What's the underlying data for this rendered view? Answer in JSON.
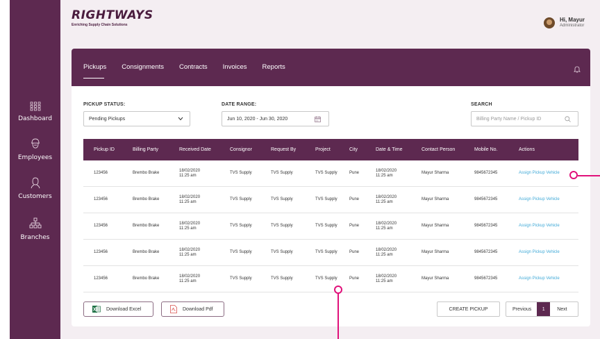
{
  "brand": {
    "name": "RIGHTWAYS",
    "tagline": "Enriching Supply Chain Solutions"
  },
  "user": {
    "greeting": "Hi, Mayur",
    "role": "Administrator"
  },
  "sidebar": {
    "items": [
      {
        "label": "Dashboard",
        "icon": "grid-icon"
      },
      {
        "label": "Employees",
        "icon": "helmet-icon"
      },
      {
        "label": "Customers",
        "icon": "person-icon"
      },
      {
        "label": "Branches",
        "icon": "hierarchy-icon"
      }
    ]
  },
  "tabs": [
    {
      "label": "Pickups",
      "active": true
    },
    {
      "label": "Consignments"
    },
    {
      "label": "Contracts"
    },
    {
      "label": "Invoices"
    },
    {
      "label": "Reports"
    }
  ],
  "filters": {
    "status_label": "PICKUP STATUS:",
    "status_value": "Pending Pickups",
    "date_label": "DATE RANGE:",
    "date_value": "Jun 10, 2020 - Jun 30, 2020",
    "search_label": "SEARCH",
    "search_placeholder": "Billing Party Name / Pickup ID"
  },
  "table": {
    "columns": [
      "Pickup ID",
      "Billing Party",
      "Received Date",
      "Consignor",
      "Request By",
      "Project",
      "City",
      "Date & Time",
      "Contact Person",
      "Mobile No.",
      "Actions"
    ],
    "rows": [
      {
        "pickup_id": "123456",
        "billing_party": "Brembo Brake",
        "received_date": "18/02/2020",
        "received_time": "11:25 am",
        "consignor": "TVS Supply",
        "request_by": "TVS Supply",
        "project": "TVS Supply",
        "city": "Pune",
        "date": "18/02/2020",
        "time": "11:25 am",
        "contact": "Mayur Sharma",
        "mobile": "9845672345",
        "action": "Assign Pickup Vehicle"
      },
      {
        "pickup_id": "123456",
        "billing_party": "Brembo Brake",
        "received_date": "18/02/2020",
        "received_time": "11:25 am",
        "consignor": "TVS Supply",
        "request_by": "TVS Supply",
        "project": "TVS Supply",
        "city": "Pune",
        "date": "18/02/2020",
        "time": "11:25 am",
        "contact": "Mayur Sharma",
        "mobile": "9845672345",
        "action": "Assign Pickup Vehicle"
      },
      {
        "pickup_id": "123456",
        "billing_party": "Brembo Brake",
        "received_date": "18/02/2020",
        "received_time": "11:25 am",
        "consignor": "TVS Supply",
        "request_by": "TVS Supply",
        "project": "TVS Supply",
        "city": "Pune",
        "date": "18/02/2020",
        "time": "11:25 am",
        "contact": "Mayur Sharma",
        "mobile": "9845672345",
        "action": "Assign Pickup Vehicle"
      },
      {
        "pickup_id": "123456",
        "billing_party": "Brembo Brake",
        "received_date": "18/02/2020",
        "received_time": "11:25 am",
        "consignor": "TVS Supply",
        "request_by": "TVS Supply",
        "project": "TVS Supply",
        "city": "Pune",
        "date": "18/02/2020",
        "time": "11:25 am",
        "contact": "Mayur Sharma",
        "mobile": "9845672345",
        "action": "Assign Pickup Vehicle"
      },
      {
        "pickup_id": "123456",
        "billing_party": "Brembo Brake",
        "received_date": "18/02/2020",
        "received_time": "11:25 am",
        "consignor": "TVS Supply",
        "request_by": "TVS Supply",
        "project": "TVS Supply",
        "city": "Pune",
        "date": "18/02/2020",
        "time": "11:25 am",
        "contact": "Mayur Sharma",
        "mobile": "9845672345",
        "action": "Assign Pickup Vehicle"
      }
    ]
  },
  "footer": {
    "download_excel": "Download Excel",
    "download_pdf": "Download Pdf",
    "create_pickup": "CREATE PICKUP",
    "previous": "Previous",
    "page": "1",
    "next": "Next"
  },
  "colors": {
    "brand_purple": "#5d2950",
    "link_blue": "#3fa9d7",
    "marker_pink": "#e0107a",
    "page_bg": "#f4eef2"
  }
}
